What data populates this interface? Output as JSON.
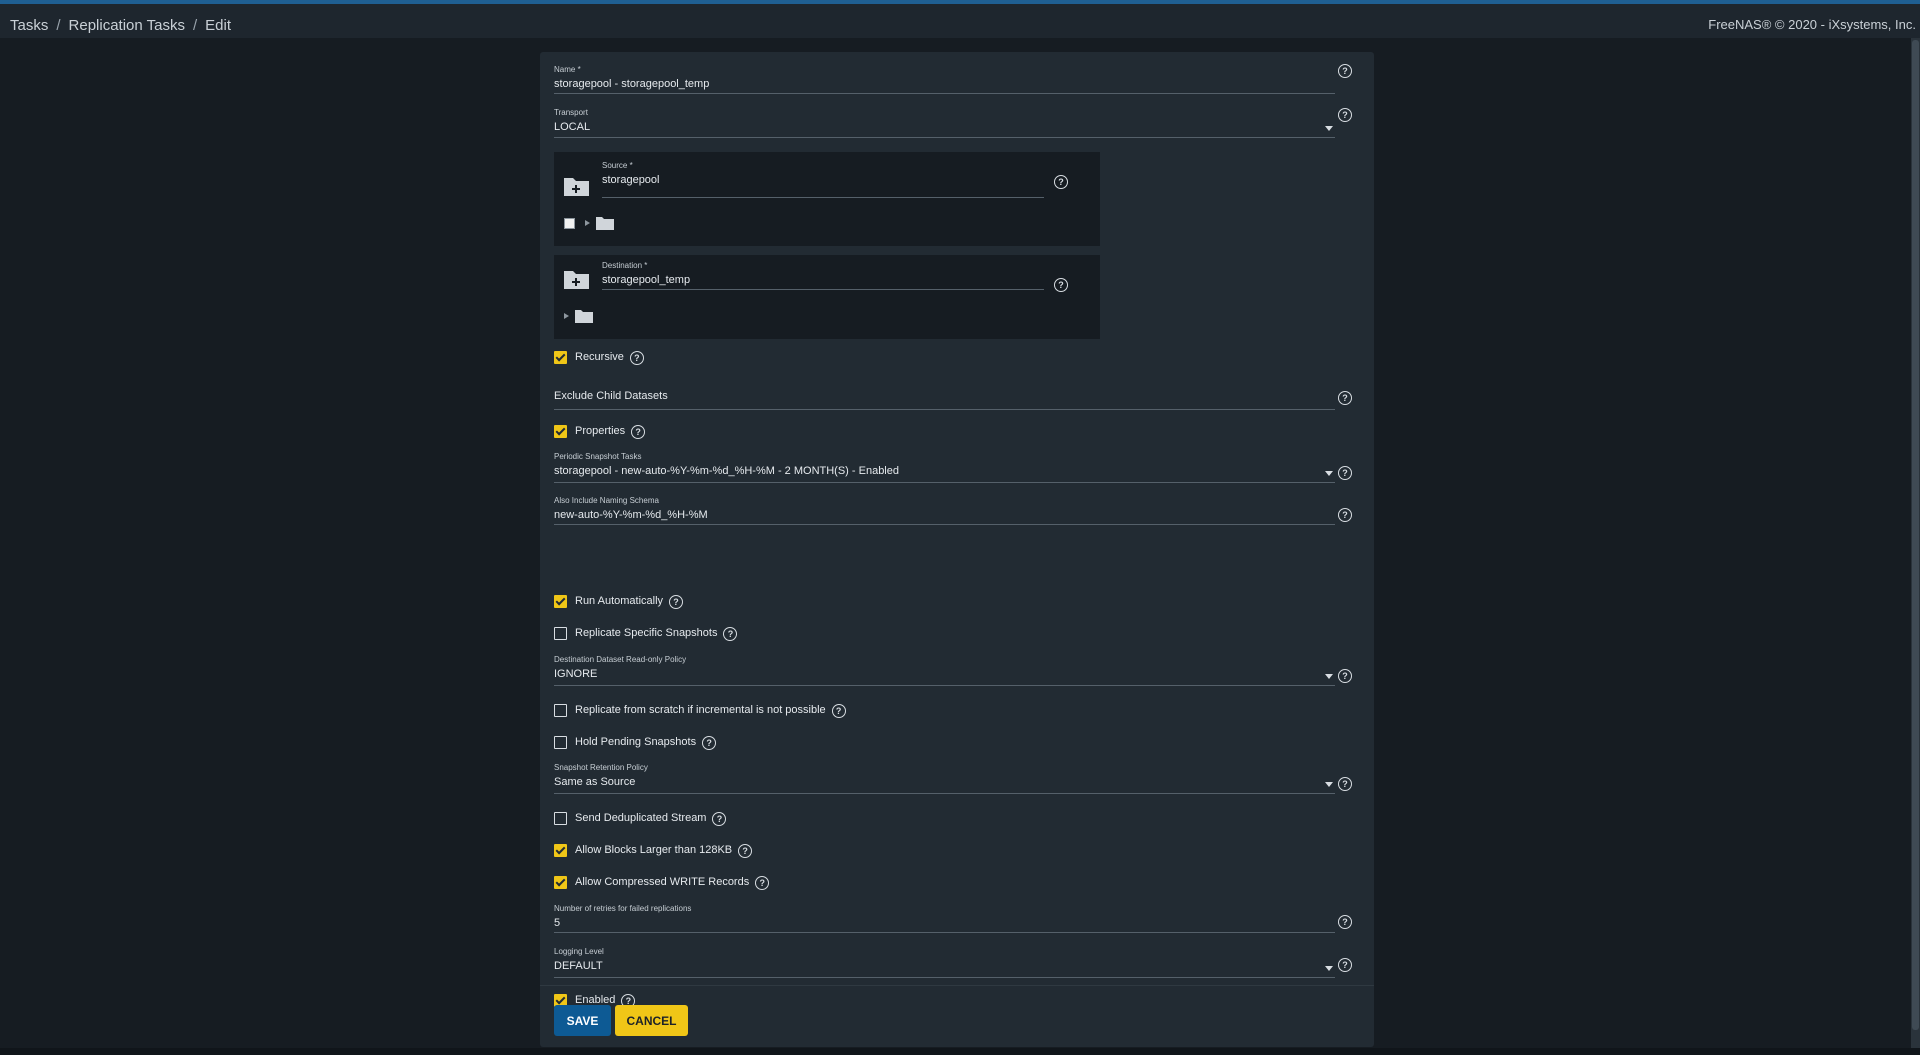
{
  "breadcrumb": [
    "Tasks",
    "Replication Tasks",
    "Edit"
  ],
  "copyright": "FreeNAS® © 2020 - iXsystems, Inc.",
  "form": {
    "name": {
      "label": "Name *",
      "value": "storagepool - storagepool_temp"
    },
    "transport": {
      "label": "Transport",
      "value": "LOCAL"
    },
    "source": {
      "label": "Source *",
      "value": "storagepool"
    },
    "destination": {
      "label": "Destination *",
      "value": "storagepool_temp"
    },
    "recursive": {
      "label": "Recursive",
      "checked": true
    },
    "exclude_child": {
      "label": "Exclude Child Datasets"
    },
    "properties": {
      "label": "Properties",
      "checked": true
    },
    "periodic": {
      "label": "Periodic Snapshot Tasks",
      "value": "storagepool - new-auto-%Y-%m-%d_%H-%M - 2 MONTH(S) - Enabled"
    },
    "naming_schema": {
      "label": "Also Include Naming Schema",
      "value": "new-auto-%Y-%m-%d_%H-%M"
    },
    "run_auto": {
      "label": "Run Automatically",
      "checked": true
    },
    "replicate_specific": {
      "label": "Replicate Specific Snapshots",
      "checked": false
    },
    "readonly_policy": {
      "label": "Destination Dataset Read-only Policy",
      "value": "IGNORE"
    },
    "from_scratch": {
      "label": "Replicate from scratch if incremental is not possible",
      "checked": false
    },
    "hold_pending": {
      "label": "Hold Pending Snapshots",
      "checked": false
    },
    "retention": {
      "label": "Snapshot Retention Policy",
      "value": "Same as Source"
    },
    "dedup": {
      "label": "Send Deduplicated Stream",
      "checked": false
    },
    "large_blocks": {
      "label": "Allow Blocks Larger than 128KB",
      "checked": true
    },
    "compressed": {
      "label": "Allow Compressed WRITE Records",
      "checked": true
    },
    "retries": {
      "label": "Number of retries for failed replications",
      "value": "5"
    },
    "logging": {
      "label": "Logging Level",
      "value": "DEFAULT"
    },
    "enabled": {
      "label": "Enabled",
      "checked": true
    }
  },
  "buttons": {
    "save": "SAVE",
    "cancel": "CANCEL"
  },
  "icons": {
    "help": "help-circle-icon",
    "folder_add": "folder-plus-icon",
    "folder": "folder-icon",
    "expand": "triangle-right-icon",
    "dropdown": "caret-down-icon"
  },
  "colors": {
    "accent": "#f0c617",
    "primary": "#0d5a94",
    "background": "#161c22",
    "card": "#222b33"
  }
}
